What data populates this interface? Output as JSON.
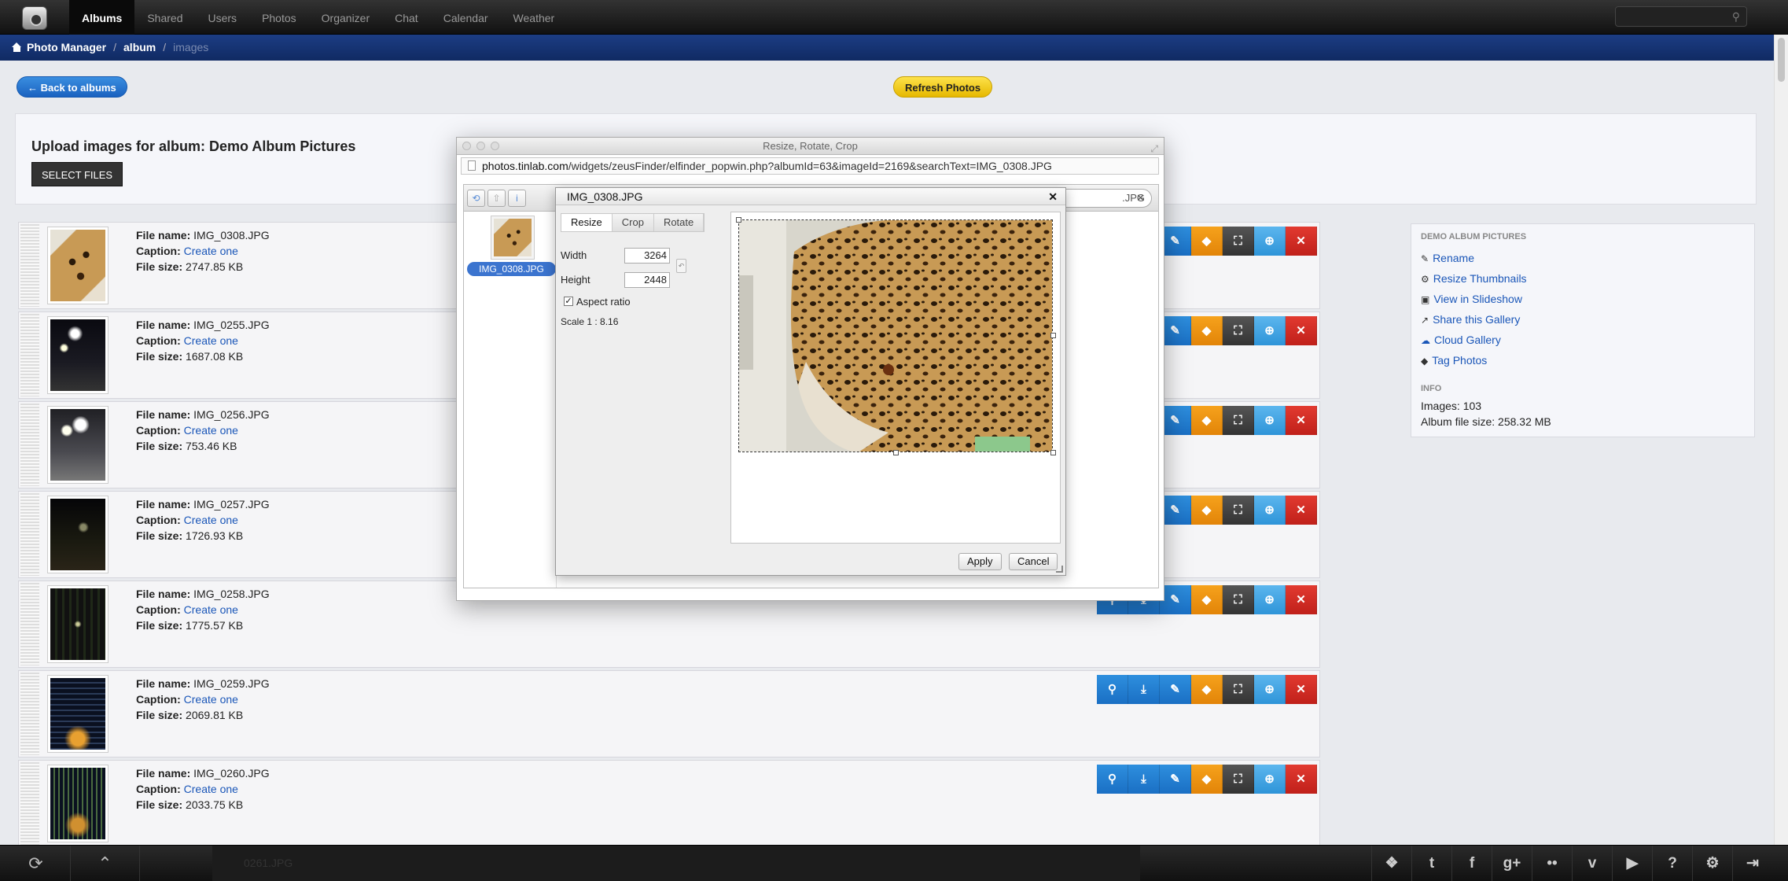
{
  "nav": {
    "items": [
      "Albums",
      "Shared",
      "Users",
      "Photos",
      "Organizer",
      "Chat",
      "Calendar",
      "Weather"
    ],
    "active": "Albums"
  },
  "breadcrumb": {
    "home": "Photo Manager",
    "album": "album",
    "current": "images"
  },
  "buttons": {
    "back": "← Back to albums",
    "refresh": "Refresh Photos"
  },
  "upload": {
    "title": "Upload images for album: Demo Album Pictures",
    "select_files": "SELECT FILES"
  },
  "labels": {
    "file_name": "File name:",
    "caption": "Caption:",
    "file_size": "File size:",
    "create_one": "Create one"
  },
  "images": [
    {
      "name": "IMG_0308.JPG",
      "size": "2747.85 KB"
    },
    {
      "name": "IMG_0255.JPG",
      "size": "1687.08 KB"
    },
    {
      "name": "IMG_0256.JPG",
      "size": "753.46 KB"
    },
    {
      "name": "IMG_0257.JPG",
      "size": "1726.93 KB"
    },
    {
      "name": "IMG_0258.JPG",
      "size": "1775.57 KB"
    },
    {
      "name": "IMG_0259.JPG",
      "size": "2069.81 KB"
    },
    {
      "name": "IMG_0260.JPG",
      "size": "2033.75 KB"
    }
  ],
  "row_actions": [
    {
      "icon": "zoom-icon",
      "glyph": "⚲"
    },
    {
      "icon": "download-icon",
      "glyph": "⤓"
    },
    {
      "icon": "edit-icon",
      "glyph": "✎"
    },
    {
      "icon": "tag-icon",
      "glyph": "◆"
    },
    {
      "icon": "fullscreen-icon",
      "glyph": "⛶"
    },
    {
      "icon": "add-icon",
      "glyph": "⊕"
    },
    {
      "icon": "delete-icon",
      "glyph": "✕"
    }
  ],
  "sidebar": {
    "section_title": "DEMO ALBUM PICTURES",
    "links": [
      {
        "label": "Rename",
        "icon": "pencil-icon",
        "glyph": "✎"
      },
      {
        "label": "Resize Thumbnails",
        "icon": "gear-icon",
        "glyph": "⚙"
      },
      {
        "label": "View in Slideshow",
        "icon": "image-icon",
        "glyph": "▣"
      },
      {
        "label": "Share this Gallery",
        "icon": "share-icon",
        "glyph": "↗"
      },
      {
        "label": "Cloud Gallery",
        "icon": "cloud-icon",
        "glyph": "☁"
      },
      {
        "label": "Tag Photos",
        "icon": "tag-icon",
        "glyph": "◆"
      }
    ],
    "info_title": "INFO",
    "images_count": "Images: 103",
    "album_size": "Album file size: 258.32 MB"
  },
  "popup": {
    "window_title": "Resize, Rotate, Crop",
    "url_host": "photos.tinlab.com",
    "url_path": "/widgets/zeusFinder/elfinder_popwin.php?albumId=63&imageId=2169&searchText=IMG_0308.JPG",
    "search_value": ".JPG",
    "file_label": "IMG_0308.JPG",
    "dialog_title": "IMG_0308.JPG",
    "tabs": [
      "Resize",
      "Crop",
      "Rotate"
    ],
    "width_label": "Width",
    "width_value": "3264",
    "height_label": "Height",
    "height_value": "2448",
    "aspect_label": "Aspect ratio",
    "aspect_checked": true,
    "scale": "Scale 1 : 8.16",
    "apply": "Apply",
    "cancel": "Cancel"
  },
  "bottom": {
    "ghost_text": "0261.JPG",
    "social": [
      "dropbox-icon",
      "twitter-icon",
      "facebook-icon",
      "google-plus-icon",
      "flickr-icon",
      "vimeo-icon",
      "youtube-icon",
      "help-icon",
      "settings-icon",
      "logout-icon"
    ]
  },
  "colors": {
    "primary": "#1a6fc4",
    "refresh": "#f2cf1f",
    "tag": "#f09214",
    "delete": "#d42a22",
    "nav_dark": "#111111",
    "crumb": "#163476"
  }
}
